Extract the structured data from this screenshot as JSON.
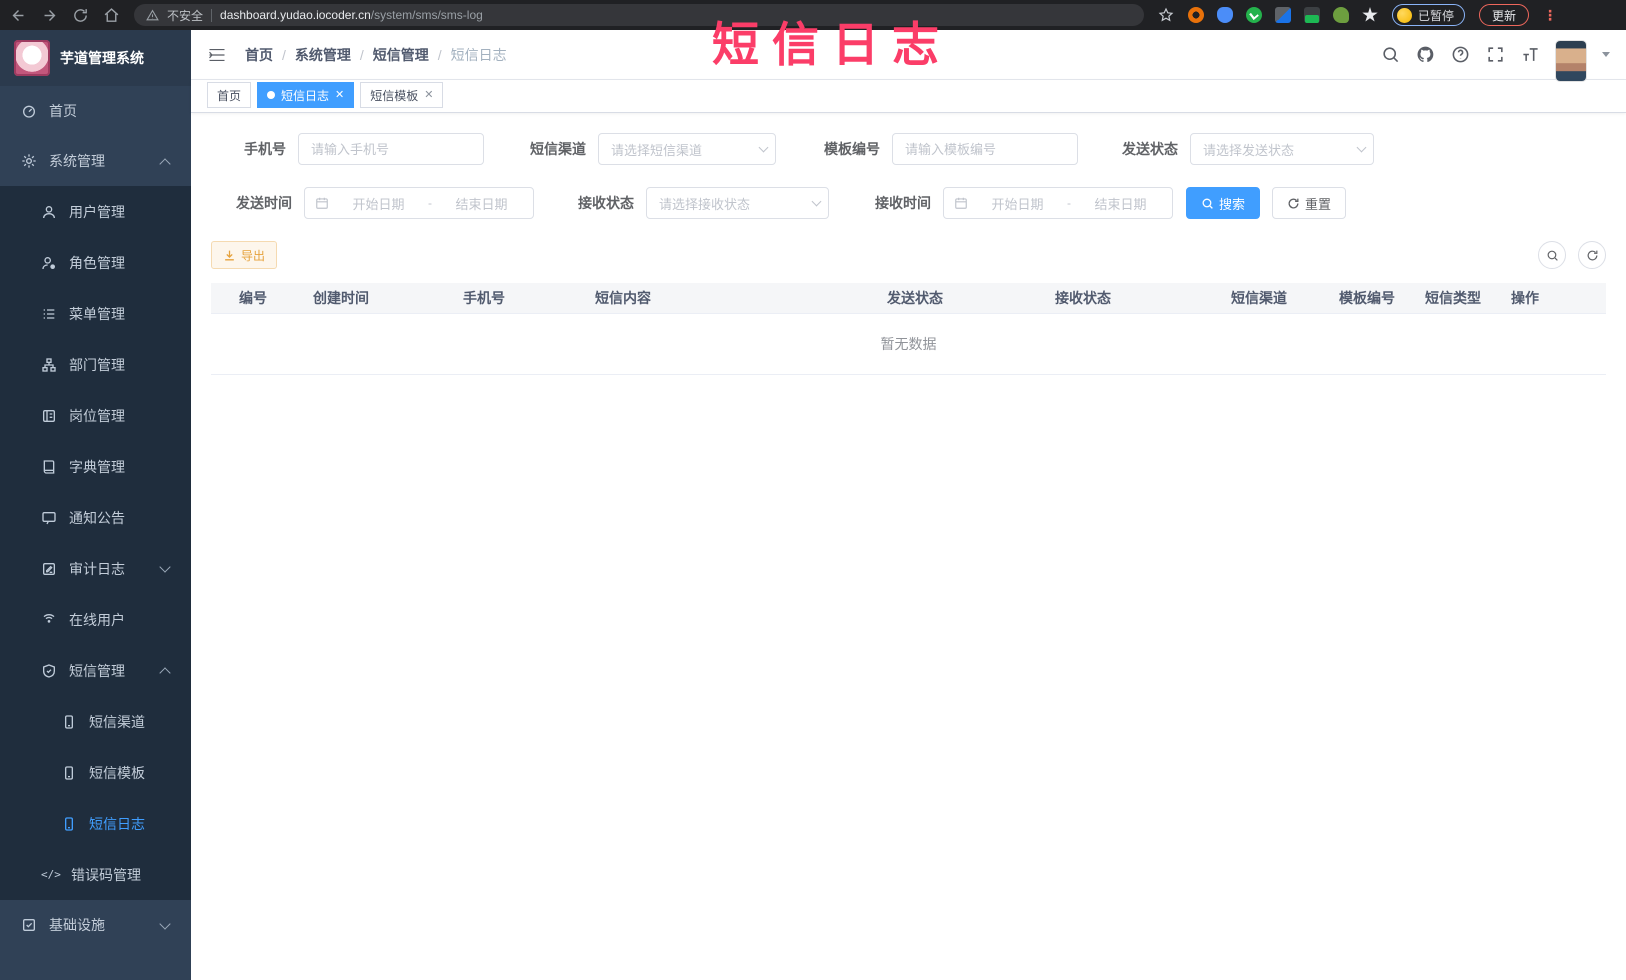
{
  "browser": {
    "security_label": "不安全",
    "url_host": "dashboard.yudao.iocoder.cn",
    "url_path": "/system/sms/sms-log",
    "paused_label": "已暂停",
    "update_label": "更新"
  },
  "overlay_title": "短信日志",
  "sidebar": {
    "app_title": "芋道管理系统",
    "items": [
      {
        "label": "首页",
        "icon": "dashboard-icon"
      },
      {
        "label": "系统管理",
        "icon": "gear-icon"
      },
      {
        "label": "用户管理",
        "icon": "user-icon"
      },
      {
        "label": "角色管理",
        "icon": "role-icon"
      },
      {
        "label": "菜单管理",
        "icon": "menu-list-icon"
      },
      {
        "label": "部门管理",
        "icon": "org-tree-icon"
      },
      {
        "label": "岗位管理",
        "icon": "post-badge-icon"
      },
      {
        "label": "字典管理",
        "icon": "dictionary-icon"
      },
      {
        "label": "通知公告",
        "icon": "announcement-icon"
      },
      {
        "label": "审计日志",
        "icon": "audit-log-icon"
      },
      {
        "label": "在线用户",
        "icon": "online-users-icon"
      },
      {
        "label": "短信管理",
        "icon": "sms-shield-icon"
      },
      {
        "label": "短信渠道",
        "icon": "phone-icon"
      },
      {
        "label": "短信模板",
        "icon": "phone-icon"
      },
      {
        "label": "短信日志",
        "icon": "phone-icon"
      },
      {
        "label": "错误码管理",
        "icon": "code-icon"
      },
      {
        "label": "基础设施",
        "icon": "infrastructure-icon"
      }
    ]
  },
  "breadcrumb": [
    "首页",
    "系统管理",
    "短信管理",
    "短信日志"
  ],
  "tabs": [
    {
      "label": "首页"
    },
    {
      "label": "短信日志"
    },
    {
      "label": "短信模板"
    }
  ],
  "filters": {
    "phone": {
      "label": "手机号",
      "placeholder": "请输入手机号"
    },
    "channel": {
      "label": "短信渠道",
      "placeholder": "请选择短信渠道"
    },
    "template": {
      "label": "模板编号",
      "placeholder": "请输入模板编号"
    },
    "send_status": {
      "label": "发送状态",
      "placeholder": "请选择发送状态"
    },
    "send_time": {
      "label": "发送时间",
      "start": "开始日期",
      "separator": "-",
      "end": "结束日期"
    },
    "receive_status": {
      "label": "接收状态",
      "placeholder": "请选择接收状态"
    },
    "receive_time": {
      "label": "接收时间",
      "start": "开始日期",
      "separator": "-",
      "end": "结束日期"
    },
    "search_label": "搜索",
    "reset_label": "重置"
  },
  "toolbar": {
    "export_label": "导出"
  },
  "table": {
    "columns": [
      "编号",
      "创建时间",
      "手机号",
      "短信内容",
      "发送状态",
      "接收状态",
      "短信渠道",
      "模板编号",
      "短信类型",
      "操作"
    ],
    "empty_text": "暂无数据"
  },
  "colors": {
    "accent": "#409eff",
    "sidebar_bg": "#304156",
    "submenu_bg": "#1f2d3d",
    "export_text": "#e6a23c",
    "overlay_pink": "#fb3d68"
  }
}
